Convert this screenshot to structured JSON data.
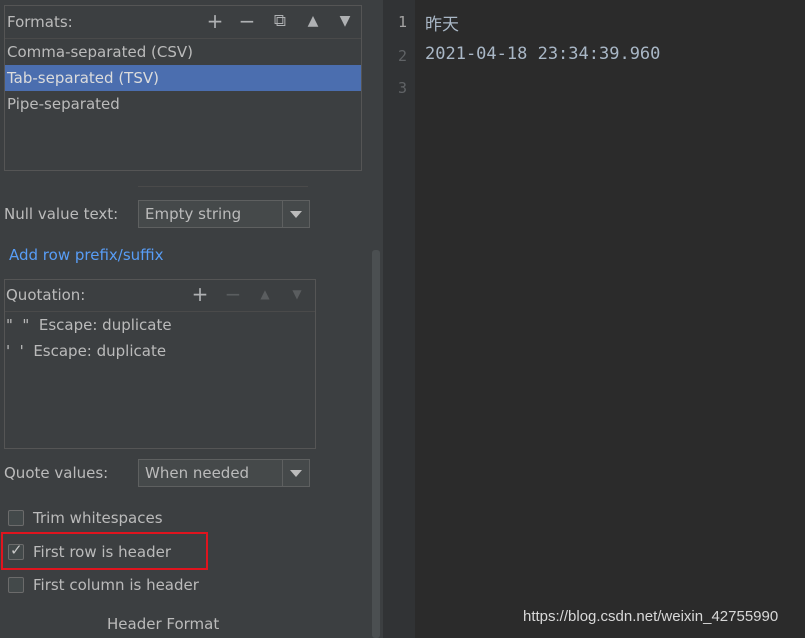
{
  "formats": {
    "title": "Formats:",
    "toolbar": {
      "add_icon": "+",
      "remove_icon": "−",
      "copy_icon": "⧉",
      "up_icon": "▲",
      "down_icon": "▼"
    },
    "items": [
      {
        "label": "Comma-separated (CSV)",
        "selected": false
      },
      {
        "label": "Tab-separated (TSV)",
        "selected": true
      },
      {
        "label": "Pipe-separated",
        "selected": false
      }
    ]
  },
  "null_value": {
    "label": "Null value text:",
    "value": "Empty string"
  },
  "add_row_link": "Add row prefix/suffix",
  "quotation": {
    "title": "Quotation:",
    "toolbar": {
      "add_icon": "+",
      "remove_icon": "−",
      "up_icon": "▲",
      "down_icon": "▼"
    },
    "items": [
      {
        "label": "\"  \"  Escape: duplicate"
      },
      {
        "label": "'  '  Escape: duplicate"
      }
    ]
  },
  "quote_values": {
    "label": "Quote values:",
    "value": "When needed"
  },
  "options": {
    "trim_whitespaces": {
      "label": "Trim whitespaces",
      "checked": false
    },
    "first_row_header": {
      "label": "First row is header",
      "checked": true
    },
    "first_column_header": {
      "label": "First column is header",
      "checked": false
    }
  },
  "header_format_label": "Header Format",
  "editor": {
    "line_numbers": [
      "1",
      "2",
      "3"
    ],
    "lines": [
      "昨天",
      "2021-04-18 23:34:39.960",
      ""
    ]
  },
  "watermark": "https://blog.csdn.net/weixin_42755990",
  "colors": {
    "selection": "#4b6eaf",
    "link": "#589df6",
    "highlight": "#e0141e",
    "editor_bg": "#2b2b2b",
    "panel_bg": "#3c3f41"
  }
}
